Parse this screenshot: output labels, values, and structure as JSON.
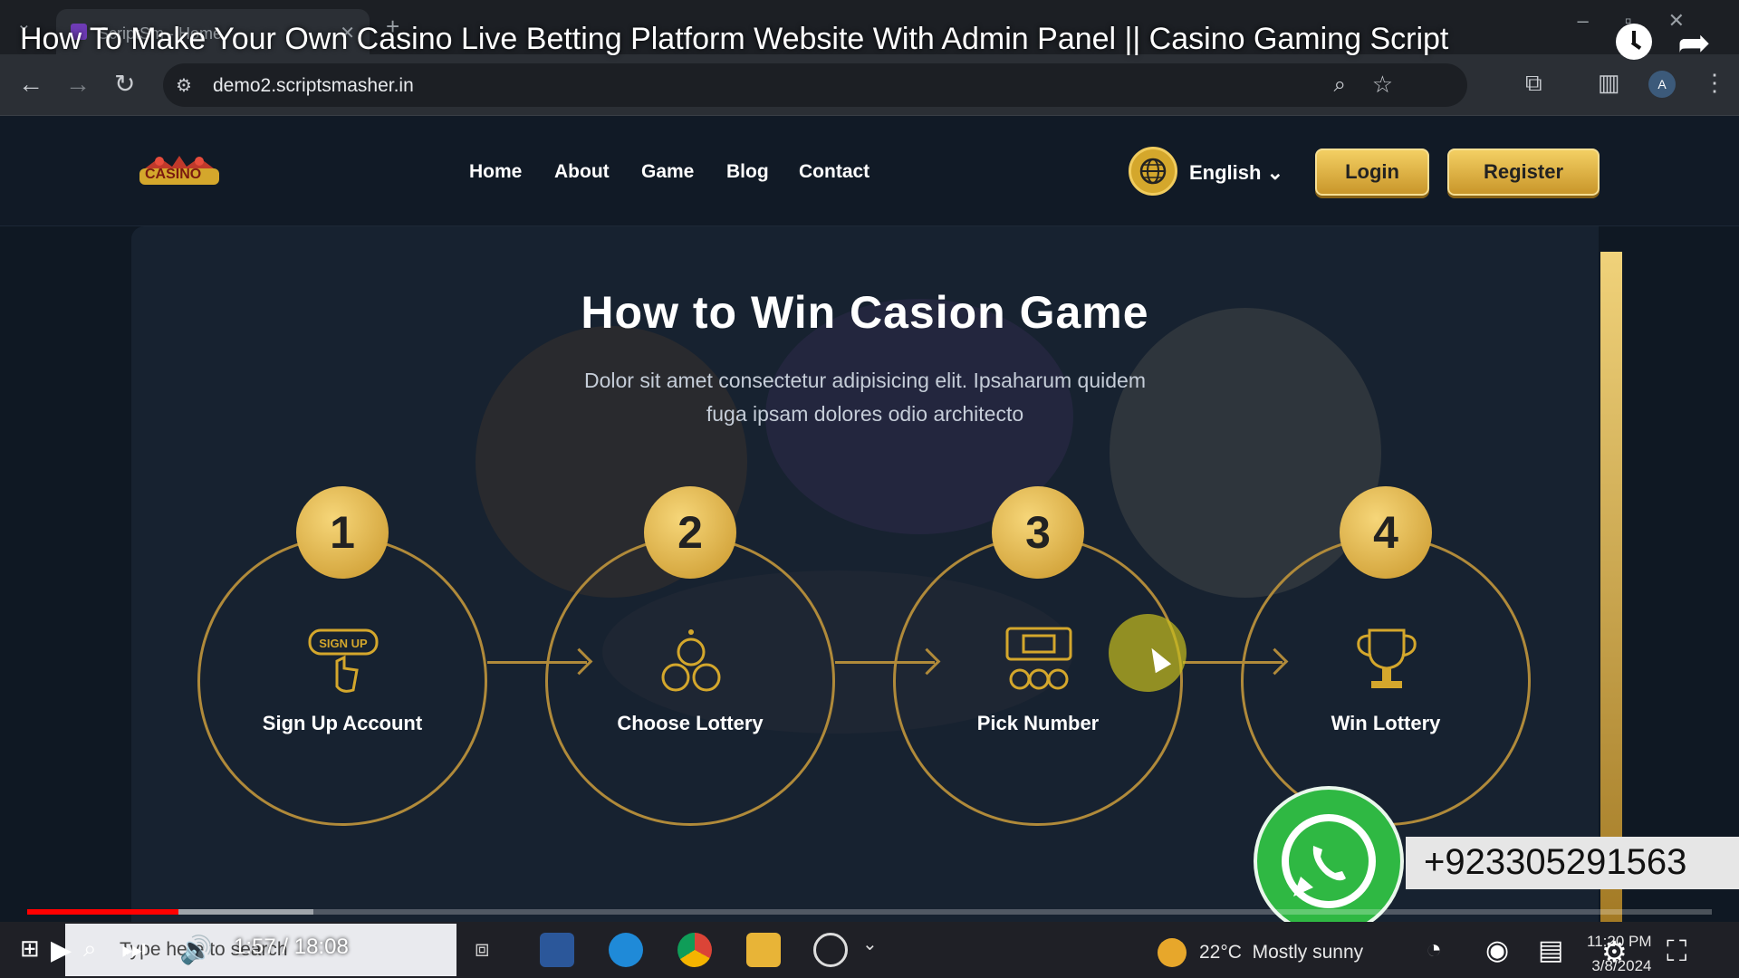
{
  "browser": {
    "tab_title": "ScriptSm - Home",
    "url": "demo2.scriptsmasher.in",
    "profile_initial": "A"
  },
  "video": {
    "title": "How To Make Your Own Casino Live Betting Platform Website With Admin Panel || Casino Gaming Script",
    "time_current": "1:57",
    "time_total": "18:08",
    "time_separator": " / ",
    "progress_played": 0.09,
    "progress_buffered": 0.17
  },
  "site": {
    "logo_text": "CASINO",
    "nav": [
      "Home",
      "About",
      "Game",
      "Blog",
      "Contact"
    ],
    "language": "English",
    "login_label": "Login",
    "register_label": "Register"
  },
  "section": {
    "title": "How to Win Casion Game",
    "description": "Dolor sit amet consectetur adipisicing elit. Ipsaharum quidem fuga ipsam dolores odio architecto",
    "steps": [
      {
        "number": "1",
        "label": "Sign Up Account",
        "icon": "signup-icon"
      },
      {
        "number": "2",
        "label": "Choose Lottery",
        "icon": "lottery-balls-icon"
      },
      {
        "number": "3",
        "label": "Pick Number",
        "icon": "ticket-icon"
      },
      {
        "number": "4",
        "label": "Win Lottery",
        "icon": "trophy-icon"
      }
    ]
  },
  "overlay": {
    "whatsapp_number": "+923305291563"
  },
  "taskbar": {
    "search_placeholder": "Type here to search",
    "weather_temp": "22°C",
    "weather_desc": "Mostly sunny",
    "time": "11:20 PM",
    "date": "3/8/2024"
  },
  "colors": {
    "accent_gold": "#d4a72c",
    "progress_red": "#ff0000",
    "whatsapp_green": "#2fb843"
  }
}
